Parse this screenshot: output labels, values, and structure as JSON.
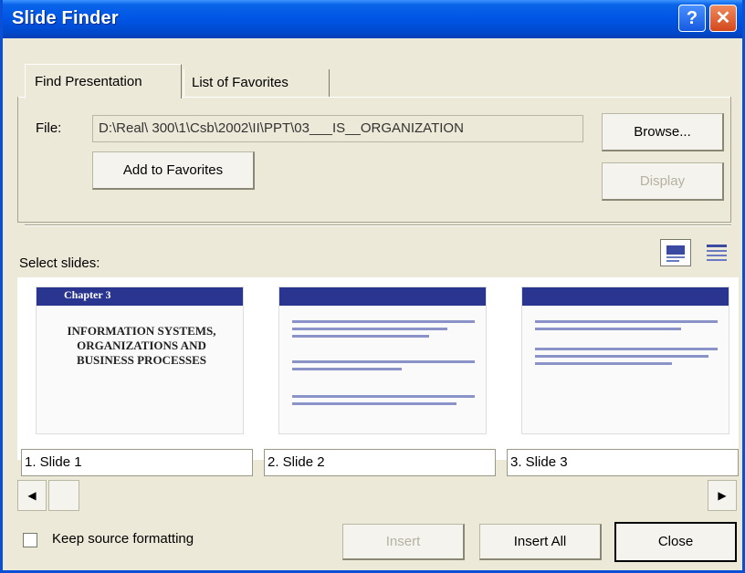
{
  "window": {
    "title": "Slide Finder",
    "help_glyph": "?",
    "close_glyph": "✕"
  },
  "tabs": [
    {
      "label": "Find Presentation",
      "active": true
    },
    {
      "label": "List of Favorites",
      "active": false
    }
  ],
  "file": {
    "label": "File:",
    "value": "D:\\Real\\   300\\1\\Csb\\2002\\II\\PPT\\03___IS__ORGANIZATION"
  },
  "buttons": {
    "browse": "Browse...",
    "add_to_favorites": "Add to Favorites",
    "display": "Display",
    "insert": "Insert",
    "insert_all": "Insert All",
    "close": "Close"
  },
  "select_slides_label": "Select slides:",
  "view_icons": [
    {
      "name": "slide-view-icon",
      "active": true
    },
    {
      "name": "title-view-icon",
      "active": false
    }
  ],
  "slides": [
    {
      "caption": "1. Slide 1",
      "header": "Chapter 3",
      "body": "INFORMATION SYSTEMS, ORGANIZATIONS AND BUSINESS PROCESSES"
    },
    {
      "caption": "2. Slide 2"
    },
    {
      "caption": "3. Slide 3"
    }
  ],
  "keep_source_formatting": {
    "label": "Keep source formatting",
    "checked": false
  },
  "colors": {
    "titlebar": "#0055e5",
    "dialog_bg": "#ece9d8",
    "slide_header": "#2a3590"
  }
}
